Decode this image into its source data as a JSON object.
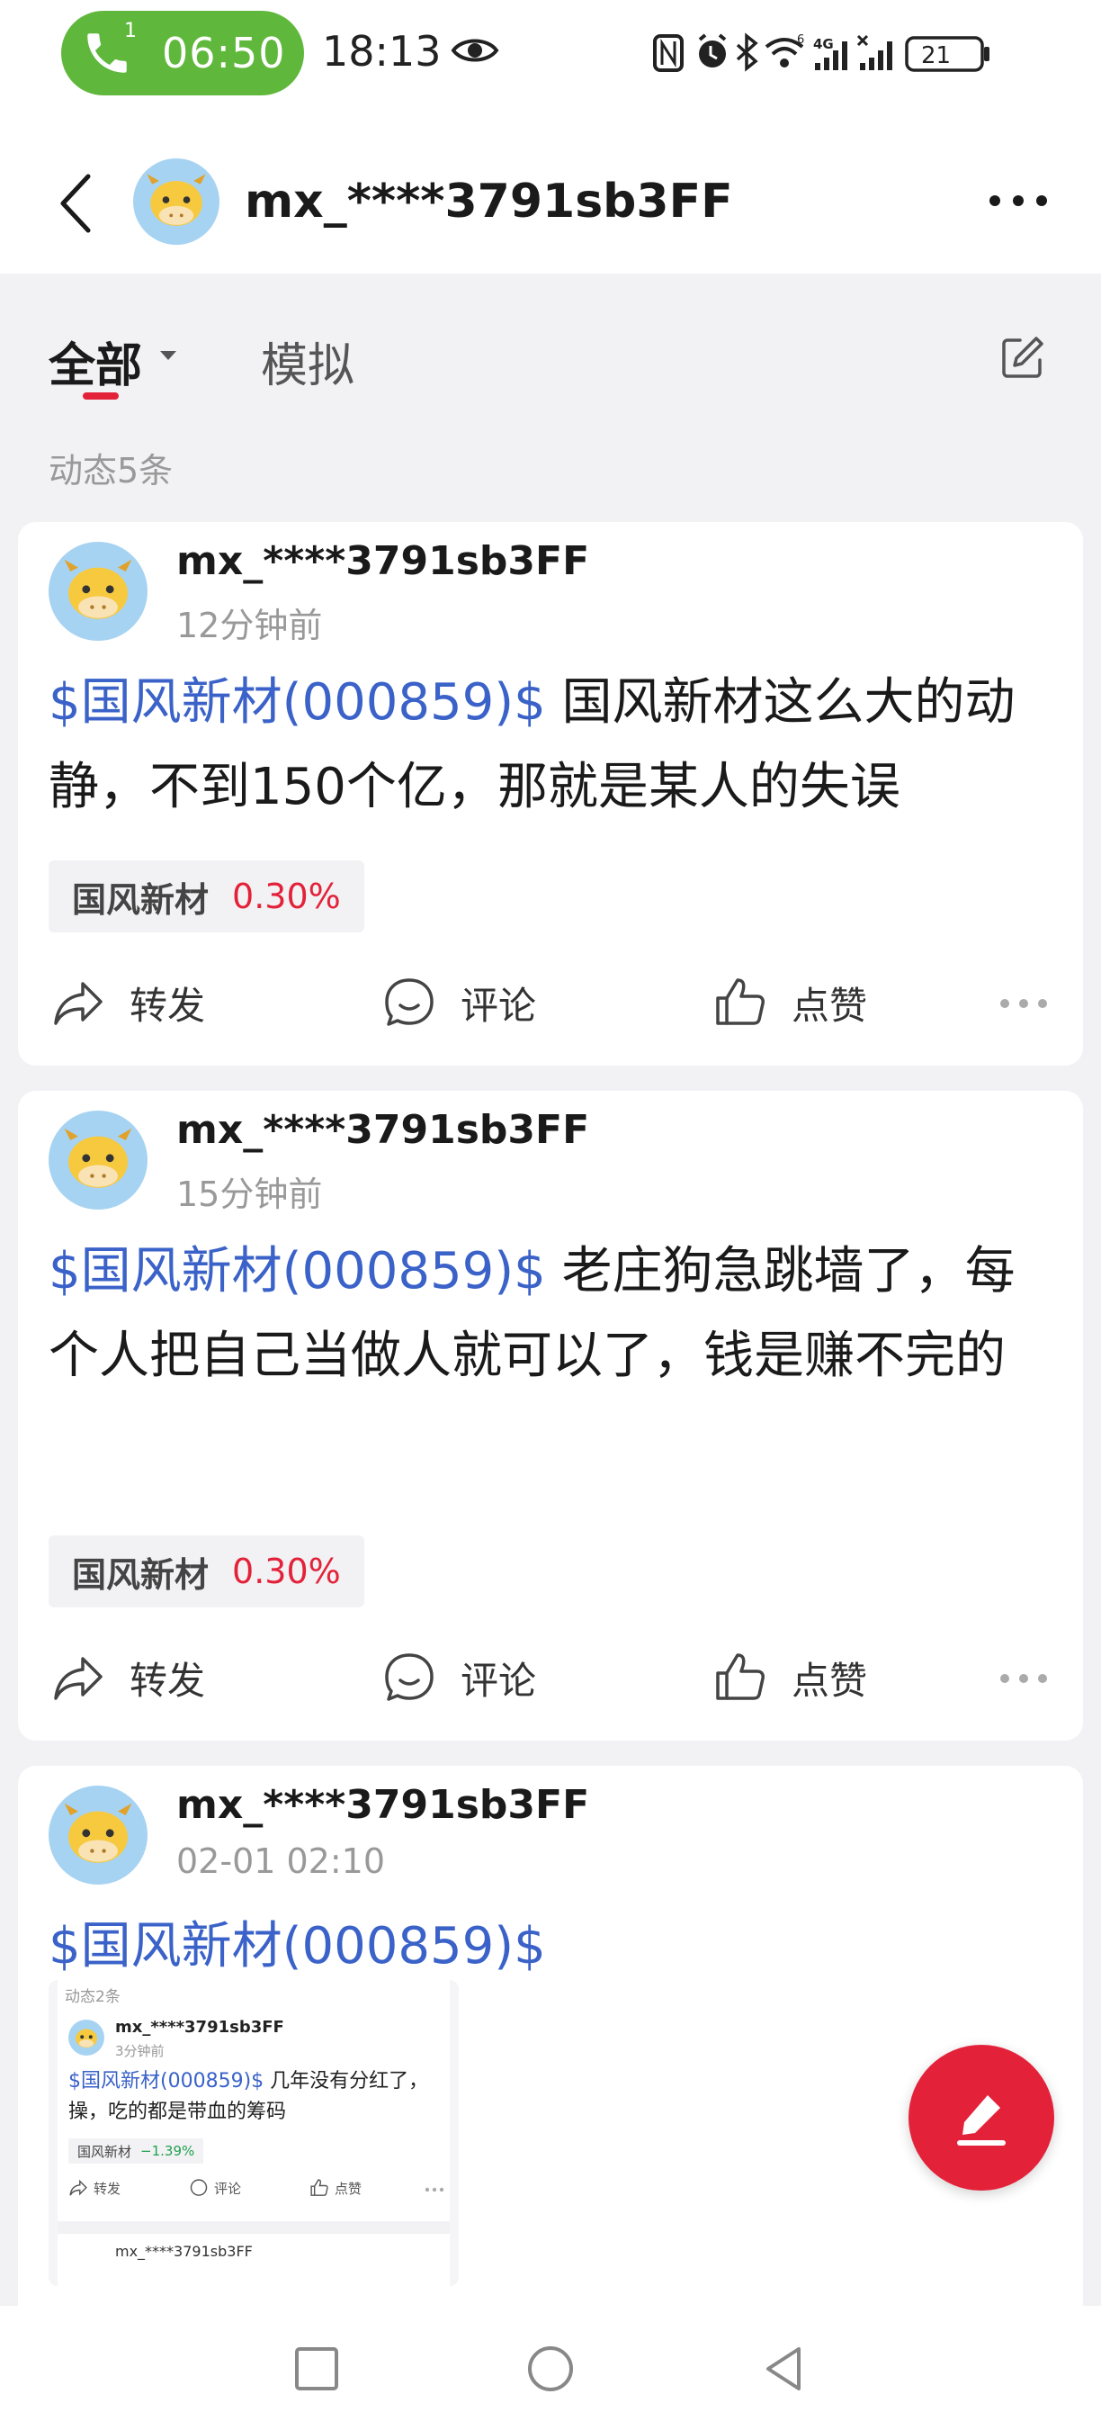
{
  "status_bar": {
    "call_sim": "1",
    "call_duration": "06:50",
    "clock": "18:13",
    "battery": "21",
    "icons": [
      "nfc-icon",
      "alarm-icon",
      "bluetooth-icon",
      "wifi-icon",
      "signal-4g-icon",
      "signal-icon",
      "battery-icon"
    ]
  },
  "header": {
    "back_icon": "back-chevron-icon",
    "username": "mx_****3791sb3FF",
    "more_icon": "more-horizontal-icon"
  },
  "filter": {
    "tabs": [
      {
        "label": "全部",
        "active": true,
        "has_dropdown": true
      },
      {
        "label": "模拟",
        "active": false
      }
    ],
    "edit_icon": "edit-icon",
    "count_label": "动态5条"
  },
  "posts": [
    {
      "username": "mx_****3791sb3FF",
      "time": "12分钟前",
      "stock_tag": "$国风新材(000859)$",
      "text": " 国风新材这么大的动静，不到150个亿，那就是某人的失误",
      "chip": {
        "name": "国风新材",
        "pct": "0.30%"
      }
    },
    {
      "username": "mx_****3791sb3FF",
      "time": "15分钟前",
      "stock_tag": "$国风新材(000859)$",
      "text": " 老庄狗急跳墙了，每个人把自己当做人就可以了，钱是赚不完的",
      "chip": {
        "name": "国风新材",
        "pct": "0.30%"
      }
    },
    {
      "username": "mx_****3791sb3FF",
      "time": "02-01 02:10",
      "stock_tag": "$国风新材(000859)$",
      "text": ""
    }
  ],
  "actions": {
    "repost": "转发",
    "comment": "评论",
    "like": "点赞"
  },
  "embedded_screenshot": {
    "count_label": "动态2条",
    "username": "mx_****3791sb3FF",
    "time": "3分钟前",
    "stock_tag": "$国风新材(000859)$",
    "text": " 几年没有分红了，操，吃的都是带血的筹码",
    "chip": {
      "name": "国风新材",
      "pct": "−1.39%"
    },
    "actions": {
      "repost": "转发",
      "comment": "评论",
      "like": "点赞"
    },
    "next_username": "mx_****3791sb3FF"
  },
  "fab_icon": "compose-pencil-icon",
  "nav": [
    "recents-square-icon",
    "home-circle-icon",
    "back-triangle-icon"
  ],
  "colors": {
    "accent_red": "#e3223a",
    "stock_blue": "#3a62c8",
    "call_green": "#5fb83c",
    "background": "#f2f2f4"
  }
}
